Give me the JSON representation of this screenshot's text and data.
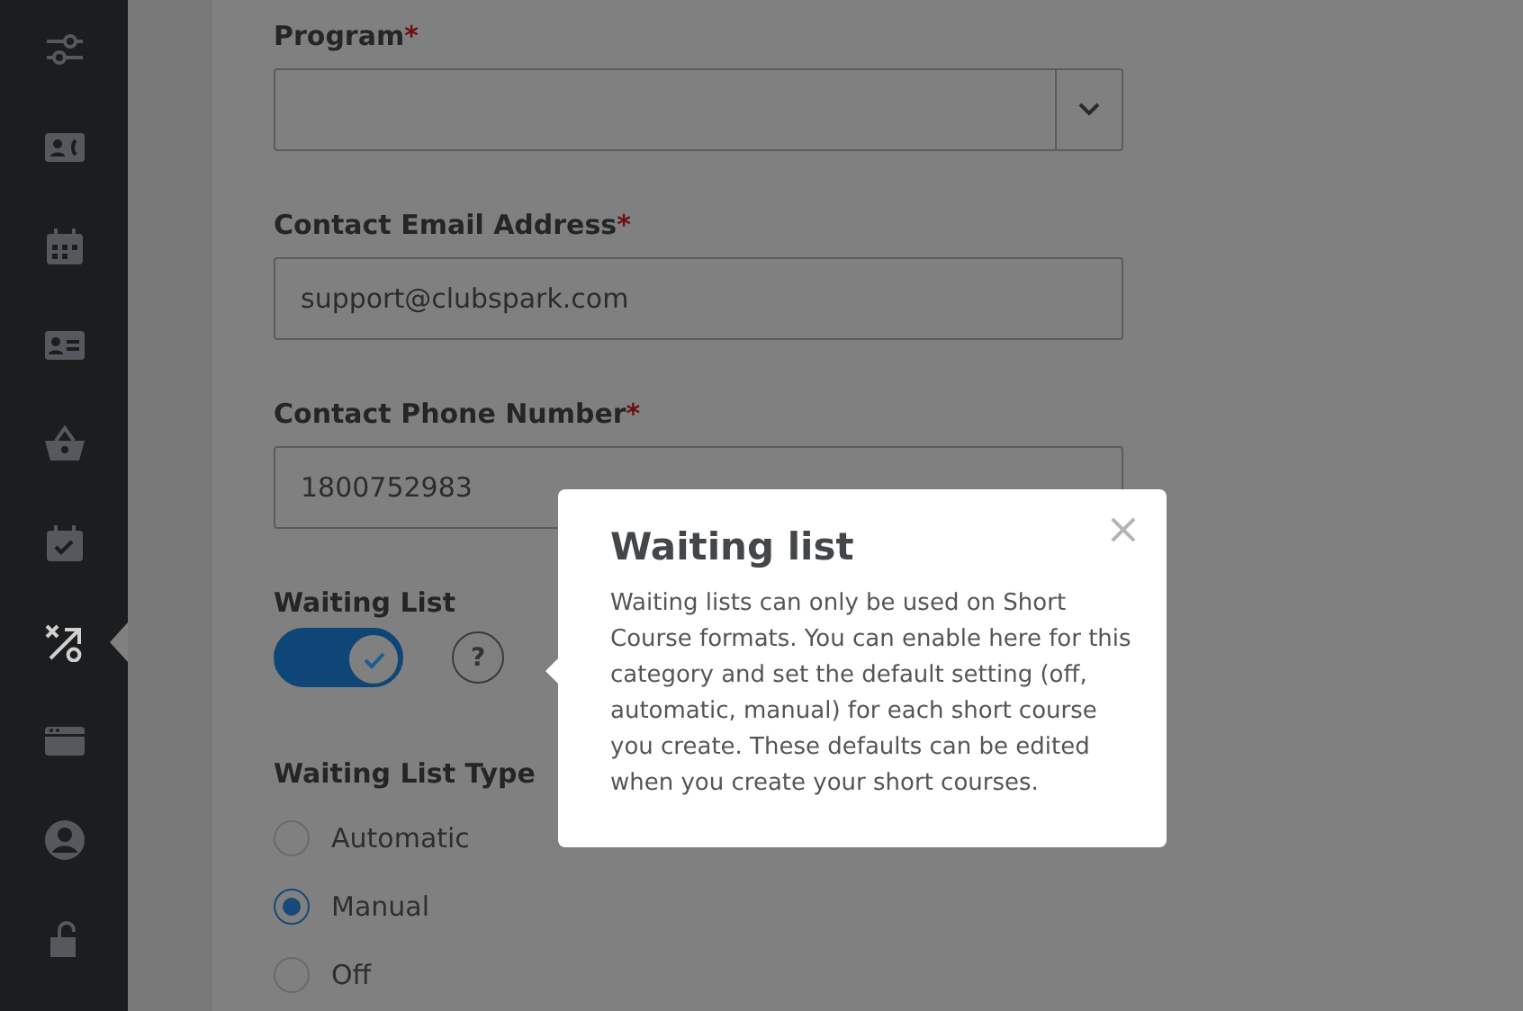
{
  "sidebar": {
    "items": [
      {
        "kind": "sliders",
        "selected": false
      },
      {
        "kind": "contact-card",
        "selected": false
      },
      {
        "kind": "calendar",
        "selected": false
      },
      {
        "kind": "id-card",
        "selected": false
      },
      {
        "kind": "basket",
        "selected": false
      },
      {
        "kind": "calendar-check",
        "selected": false
      },
      {
        "kind": "arrow-circle",
        "selected": true
      },
      {
        "kind": "browser-window",
        "selected": false
      },
      {
        "kind": "user",
        "selected": false
      },
      {
        "kind": "padlock",
        "selected": false
      }
    ]
  },
  "form": {
    "fields": [
      {
        "kind": "select",
        "label": "Program",
        "required_mark": "*"
      },
      {
        "kind": "text",
        "label": "Contact Email Address",
        "required_mark": "*",
        "value": "support@clubspark.com"
      },
      {
        "kind": "text",
        "label": "Contact Phone Number",
        "required_mark": "*",
        "value": "1800752983"
      }
    ],
    "waiting_list": {
      "label": "Waiting List",
      "on": true,
      "help": "?"
    },
    "waiting_list_type": {
      "label": "Waiting List Type",
      "options": [
        {
          "label": "Automatic",
          "selected": false
        },
        {
          "label": "Manual",
          "selected": true
        },
        {
          "label": "Off",
          "selected": false
        }
      ]
    }
  },
  "popover": {
    "title": "Waiting list",
    "close": "×",
    "body": "Waiting lists can only be used on Short Course formats. You can enable here for this category and set the default setting (off, automatic, manual) for each short course you create. These defaults can be edited when you create your short courses."
  }
}
